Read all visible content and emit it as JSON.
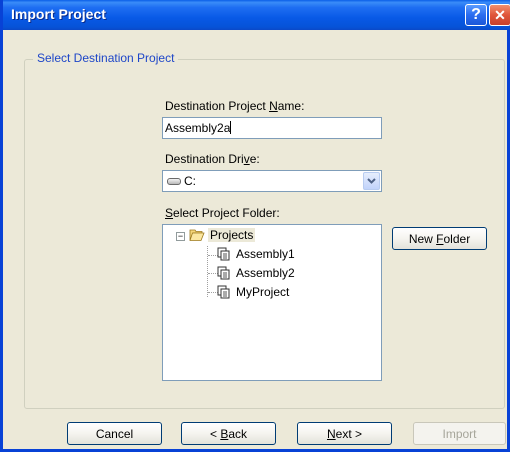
{
  "window": {
    "title": "Import Project",
    "help_glyph": "?",
    "close_glyph": "✕"
  },
  "group": {
    "legend": "Select Destination Project"
  },
  "name_field": {
    "label_pre": "Destination Project ",
    "label_mnemonic": "N",
    "label_post": "ame:",
    "value": "Assembly2a"
  },
  "drive_field": {
    "label_pre": "Destination Dri",
    "label_mnemonic": "v",
    "label_post": "e:",
    "value": "C:"
  },
  "folder_field": {
    "label_pre": "",
    "label_mnemonic": "S",
    "label_post": "elect Project Folder:"
  },
  "tree": {
    "root": {
      "label": "Projects",
      "expander": "−"
    },
    "children": [
      {
        "label": "Assembly1"
      },
      {
        "label": "Assembly2"
      },
      {
        "label": "MyProject"
      }
    ]
  },
  "buttons": {
    "new_folder": {
      "pre": "New ",
      "mnemonic": "F",
      "post": "older"
    },
    "cancel": {
      "label": "Cancel"
    },
    "back": {
      "pre": "< ",
      "mnemonic": "B",
      "post": "ack"
    },
    "next": {
      "pre": "",
      "mnemonic": "N",
      "post": "ext >"
    },
    "import": {
      "label": "Import",
      "enabled": false
    }
  },
  "colors": {
    "titlebar": "#0A5FE8",
    "dialog_bg": "#ECE9D8",
    "legend_text": "#1E46C8",
    "button_border": "#003C74"
  }
}
